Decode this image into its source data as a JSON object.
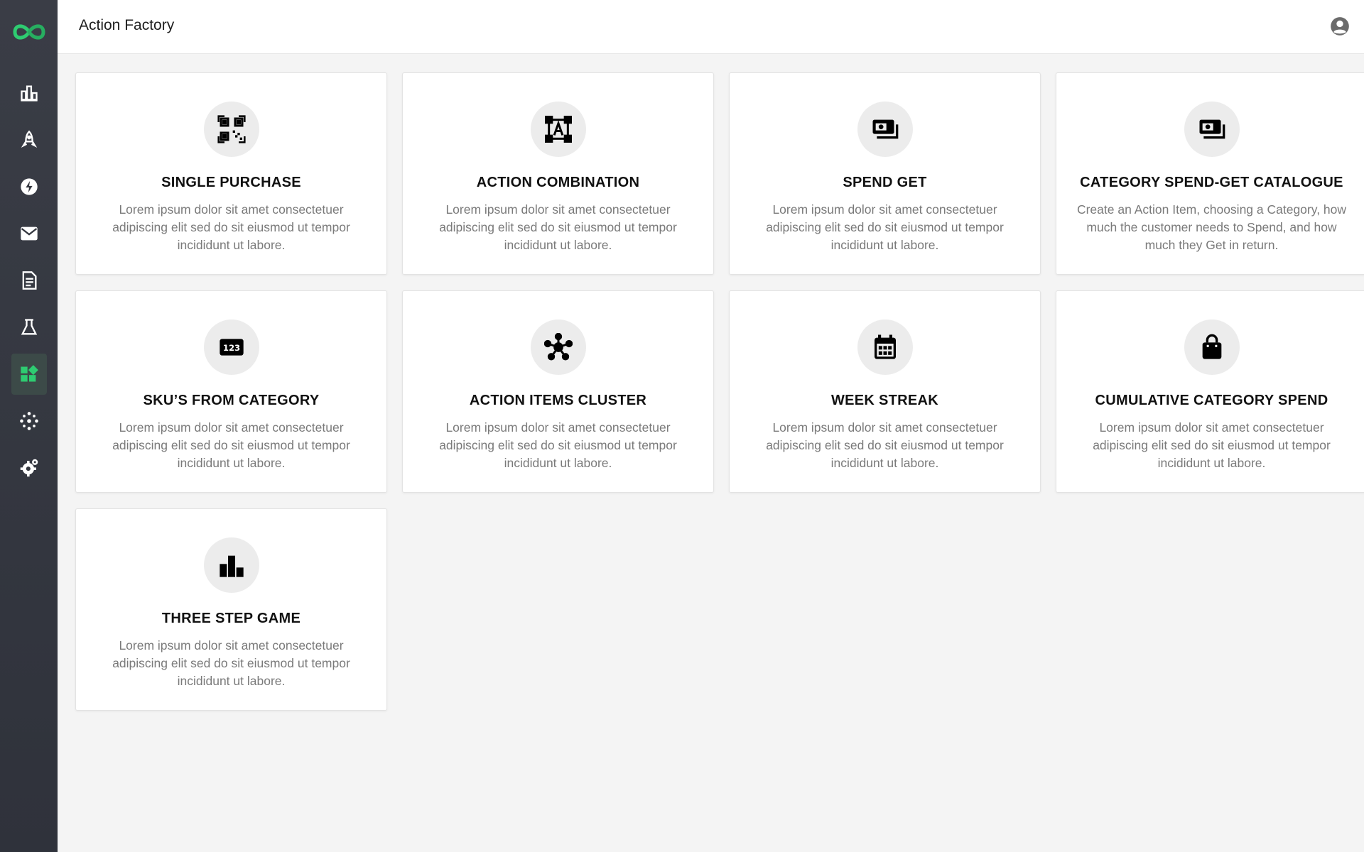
{
  "app": {
    "page_title": "Action Factory"
  },
  "sidebar": {
    "items": [
      {
        "name": "dashboard",
        "icon": "bar-chart-icon"
      },
      {
        "name": "launch",
        "icon": "rocket-icon"
      },
      {
        "name": "actions",
        "icon": "lightning-icon"
      },
      {
        "name": "messages",
        "icon": "mail-icon"
      },
      {
        "name": "reports",
        "icon": "document-icon"
      },
      {
        "name": "lab",
        "icon": "flask-icon"
      },
      {
        "name": "action-factory",
        "icon": "widgets-icon",
        "active": true
      },
      {
        "name": "cluster",
        "icon": "sparkle-icon"
      },
      {
        "name": "settings",
        "icon": "gear-icon"
      }
    ]
  },
  "colors": {
    "accent": "#2ecc71",
    "sidebar": "#34373f",
    "background": "#f4f4f4"
  },
  "cards": [
    {
      "title": "SINGLE PURCHASE",
      "icon": "qr-code-icon",
      "description": "Lorem ipsum dolor sit amet consectetuer adipiscing elit sed do sit eiusmod ut tempor incididunt ut labore."
    },
    {
      "title": "ACTION COMBINATION",
      "icon": "vector-box-icon",
      "description": "Lorem ipsum dolor sit amet consectetuer adipiscing elit sed do sit eiusmod ut tempor incididunt ut labore."
    },
    {
      "title": "SPEND GET",
      "icon": "cash-icon",
      "description": "Lorem ipsum dolor sit amet consectetuer adipiscing elit sed do sit eiusmod ut tempor incididunt ut labore."
    },
    {
      "title": "CATEGORY SPEND-GET CATALOGUE",
      "icon": "cash-icon",
      "description": "Create an Action Item, choosing a Category, how much the customer needs to Spend, and how much they Get in return."
    },
    {
      "title": "SKU’S FROM CATEGORY",
      "icon": "numeric-123-icon",
      "description": "Lorem ipsum dolor sit amet consectetuer adipiscing elit sed do sit eiusmod ut tempor incididunt ut labore."
    },
    {
      "title": "ACTION ITEMS CLUSTER",
      "icon": "cluster-icon",
      "description": "Lorem ipsum dolor sit amet consectetuer adipiscing elit sed do sit eiusmod ut tempor incididunt ut labore."
    },
    {
      "title": "WEEK STREAK",
      "icon": "calendar-icon",
      "description": "Lorem ipsum dolor sit amet consectetuer adipiscing elit sed do sit eiusmod ut tempor incididunt ut labore."
    },
    {
      "title": "CUMULATIVE CATEGORY SPEND",
      "icon": "shopping-bag-icon",
      "description": "Lorem ipsum dolor sit amet consectetuer adipiscing elit sed do sit eiusmod ut tempor incididunt ut labore."
    },
    {
      "title": "THREE STEP GAME",
      "icon": "podium-icon",
      "description": "Lorem ipsum dolor sit amet consectetuer adipiscing elit sed do sit eiusmod ut tempor incididunt ut labore."
    }
  ]
}
